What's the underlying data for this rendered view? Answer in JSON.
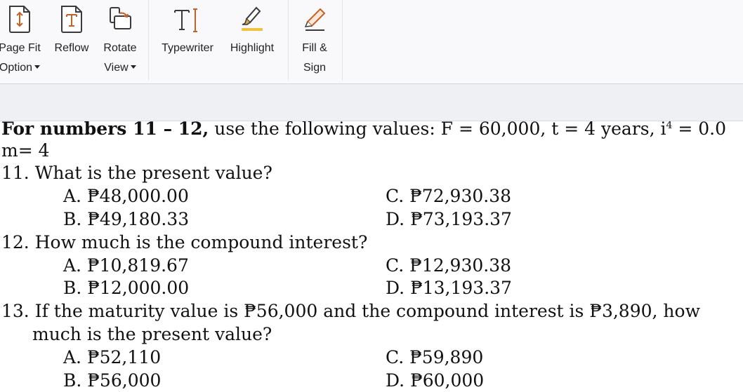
{
  "toolbar": {
    "tools": [
      {
        "id": "page-fit",
        "label_line1": "Page Fit",
        "label_line2": "Option",
        "dropdown": true,
        "icon": "page-fit-icon"
      },
      {
        "id": "reflow",
        "label_line1": "Reflow",
        "label_line2": "",
        "dropdown": false,
        "icon": "reflow-icon"
      },
      {
        "id": "rotate-view",
        "label_line1": "Rotate",
        "label_line2": "View",
        "dropdown": true,
        "icon": "rotate-view-icon"
      },
      {
        "id": "typewriter",
        "label_line1": "Typewriter",
        "label_line2": "",
        "dropdown": false,
        "icon": "typewriter-icon"
      },
      {
        "id": "highlight",
        "label_line1": "Highlight",
        "label_line2": "",
        "dropdown": false,
        "icon": "highlight-icon"
      },
      {
        "id": "fill-sign",
        "label_line1": "Fill &",
        "label_line2": "Sign",
        "dropdown": false,
        "icon": "fill-sign-icon"
      }
    ],
    "colors": {
      "accent": "#c0622a",
      "highlight": "#f0c040",
      "icon_stroke": "#3a3a3a"
    }
  },
  "document": {
    "intro": {
      "bold_part": "For numbers 11 – 12,",
      "rest_part": " use the following values: F = 60,000, t = 4 years, i",
      "superscript": "4",
      "tail": " = 0.0",
      "line2": "m= 4"
    },
    "questions": [
      {
        "number": "11.",
        "text": "What is the present value?",
        "options": [
          {
            "letter": "A.",
            "value": "₱48,000.00"
          },
          {
            "letter": "B.",
            "value": "₱49,180.33"
          },
          {
            "letter": "C.",
            "value": "₱72,930.38"
          },
          {
            "letter": "D.",
            "value": "₱73,193.37"
          }
        ]
      },
      {
        "number": "12.",
        "text": "How much is the compound interest?",
        "options": [
          {
            "letter": "A.",
            "value": "₱10,819.67"
          },
          {
            "letter": "B.",
            "value": "₱12,000.00"
          },
          {
            "letter": "C.",
            "value": "₱12,930.38"
          },
          {
            "letter": "D.",
            "value": "₱13,193.37"
          }
        ]
      },
      {
        "number": "13.",
        "text": "If the maturity value is ₱56,000 and the compound interest is ₱3,890, how",
        "text_line2": "much is the present value?",
        "options": [
          {
            "letter": "A.",
            "value": "₱52,110"
          },
          {
            "letter": "B.",
            "value": "₱56,000"
          },
          {
            "letter": "C.",
            "value": "₱59,890"
          },
          {
            "letter": "D.",
            "value": "₱60,000"
          }
        ]
      }
    ]
  }
}
